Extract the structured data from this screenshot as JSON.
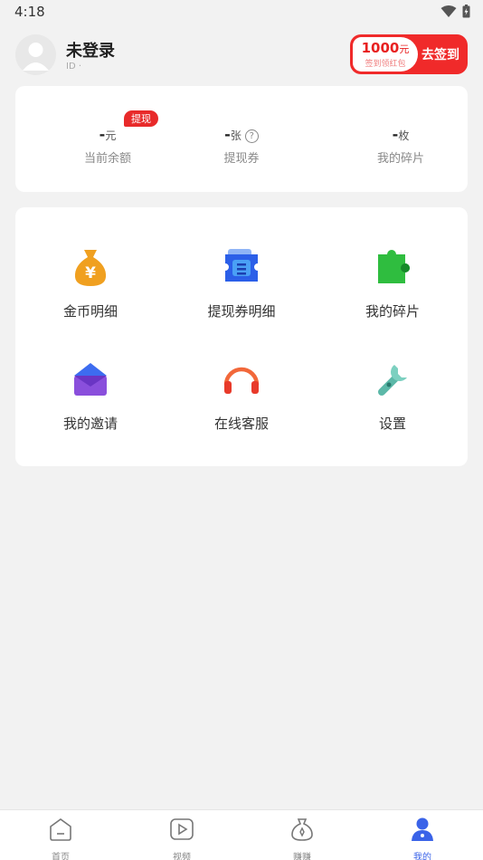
{
  "status_bar": {
    "time": "4:18"
  },
  "user": {
    "name": "未登录",
    "id_label": "ID ·"
  },
  "signin": {
    "amount": "1000",
    "unit": "元",
    "subtitle": "签到领红包",
    "button": "去签到"
  },
  "stats": [
    {
      "value": "-",
      "unit": "元",
      "label": "当前余额",
      "badge": "提现"
    },
    {
      "value": "-",
      "unit": "张",
      "label": "提现券",
      "help_icon": "?"
    },
    {
      "value": "-",
      "unit": "枚",
      "label": "我的碎片"
    }
  ],
  "menu": [
    {
      "label": "金币明细",
      "icon": "money-bag-icon"
    },
    {
      "label": "提现券明细",
      "icon": "ticket-icon"
    },
    {
      "label": "我的碎片",
      "icon": "puzzle-icon"
    },
    {
      "label": "我的邀请",
      "icon": "envelope-icon"
    },
    {
      "label": "在线客服",
      "icon": "headphones-icon"
    },
    {
      "label": "设置",
      "icon": "wrench-icon"
    }
  ],
  "tabs": [
    {
      "label": "首页",
      "icon": "home-icon"
    },
    {
      "label": "视频",
      "icon": "video-icon"
    },
    {
      "label": "赚赚",
      "icon": "earn-icon"
    },
    {
      "label": "我的",
      "icon": "profile-icon",
      "active": true
    }
  ],
  "colors": {
    "accent": "#3a63e8",
    "red": "#e82a2a"
  }
}
